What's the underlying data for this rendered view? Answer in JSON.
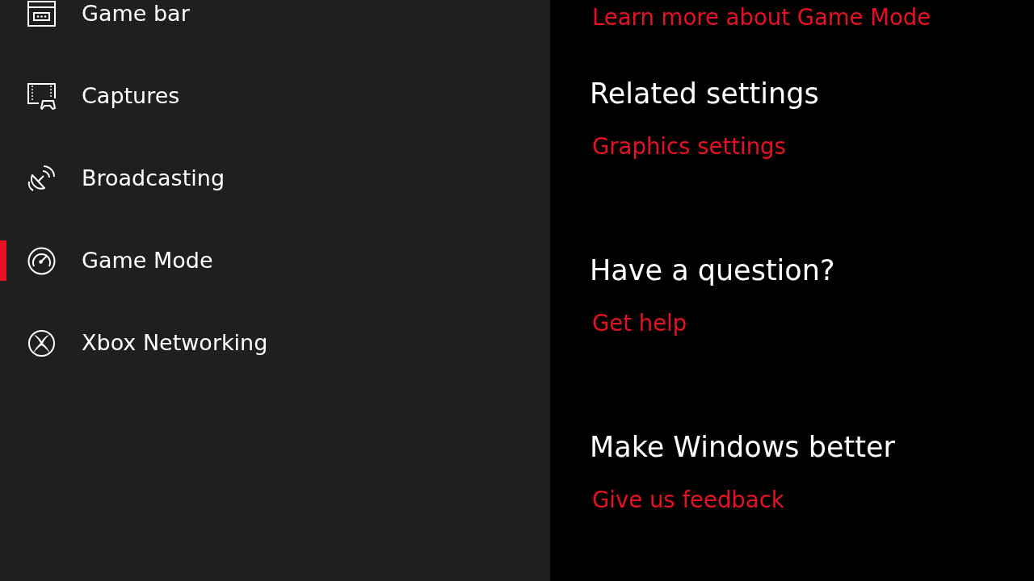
{
  "sidebar": {
    "items": [
      {
        "label": "Game bar",
        "selected": false
      },
      {
        "label": "Captures",
        "selected": false
      },
      {
        "label": "Broadcasting",
        "selected": false
      },
      {
        "label": "Game Mode",
        "selected": true
      },
      {
        "label": "Xbox Networking",
        "selected": false
      }
    ]
  },
  "content": {
    "top_link": "Learn more about Game Mode",
    "sections": [
      {
        "heading": "Related settings",
        "link": "Graphics settings"
      },
      {
        "heading": "Have a question?",
        "link": "Get help"
      },
      {
        "heading": "Make Windows better",
        "link": "Give us feedback"
      }
    ]
  }
}
